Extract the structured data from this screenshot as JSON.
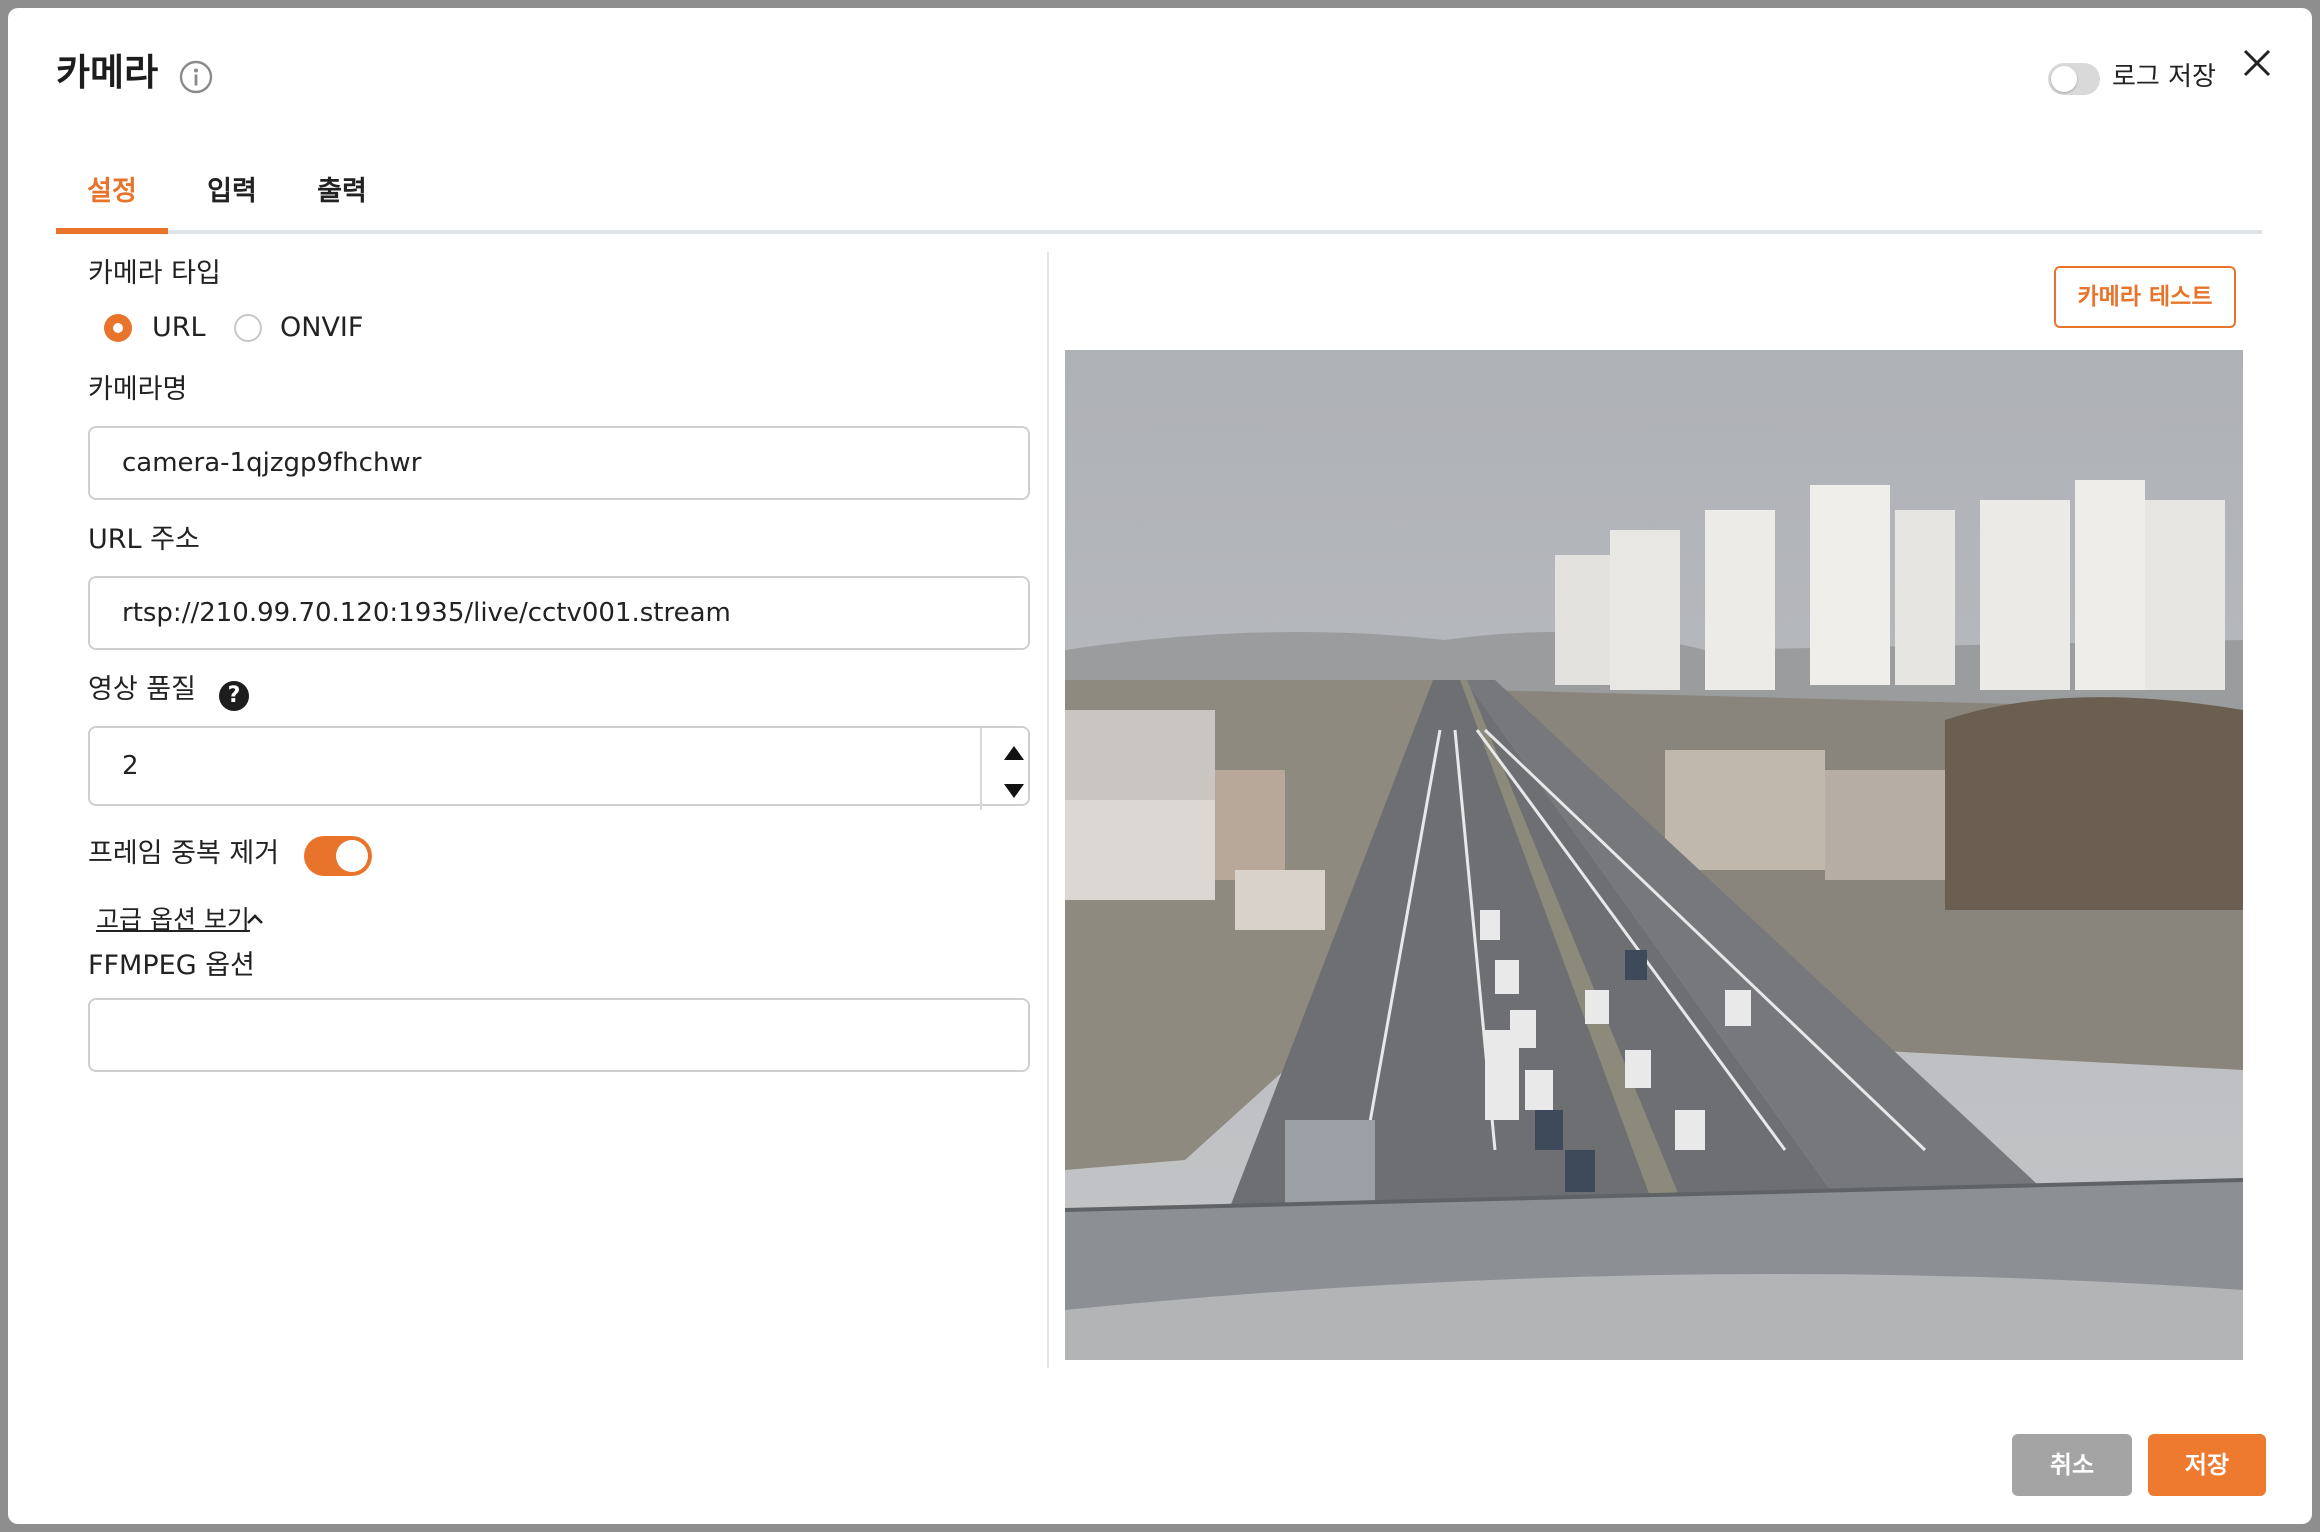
{
  "header": {
    "title": "카메라",
    "log_save_label": "로그 저장",
    "log_save_enabled": false
  },
  "tabs": [
    {
      "label": "설정",
      "active": true
    },
    {
      "label": "입력",
      "active": false
    },
    {
      "label": "출력",
      "active": false
    }
  ],
  "form": {
    "camera_type_label": "카메라 타입",
    "camera_type_options": [
      {
        "label": "URL",
        "selected": true
      },
      {
        "label": "ONVIF",
        "selected": false
      }
    ],
    "camera_name_label": "카메라명",
    "camera_name_value": "camera-1qjzgp9fhchwr",
    "url_label": "URL 주소",
    "url_value": "rtsp://210.99.70.120:1935/live/cctv001.stream",
    "quality_label": "영상 품질",
    "quality_value": "2",
    "dedup_label": "프레임 중복 제거",
    "dedup_enabled": true,
    "advanced_link": "고급 옵션 보기",
    "ffmpeg_label": "FFMPEG 옵션",
    "ffmpeg_value": ""
  },
  "preview": {
    "test_button": "카메라 테스트"
  },
  "footer": {
    "cancel_label": "취소",
    "save_label": "저장"
  },
  "colors": {
    "accent": "#e8742c",
    "cancel_bg": "#a4a4a4",
    "toggle_off": "#d9d9d9"
  },
  "icons": {
    "info": "info-icon",
    "close": "close-icon",
    "help": "help-icon",
    "chevron": "chevron-up-icon",
    "spin_up": "spin-up-icon",
    "spin_down": "spin-down-icon"
  }
}
